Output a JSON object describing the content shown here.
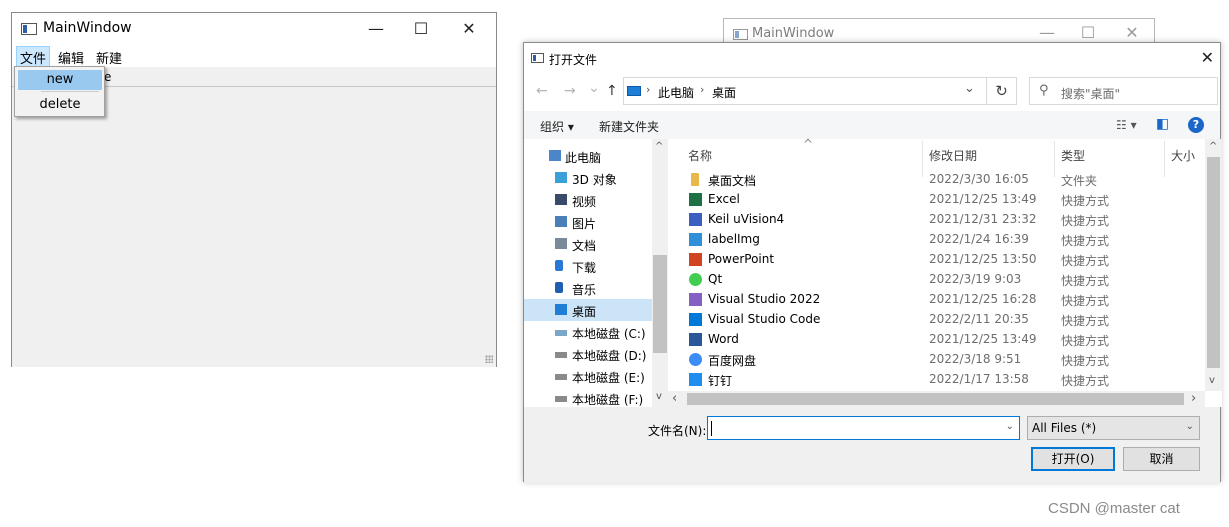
{
  "main_window": {
    "title": "MainWindow",
    "controls": {
      "minimize": "—",
      "maximize": "☐",
      "close": "✕"
    },
    "menu": [
      "文件",
      "编辑",
      "新建"
    ],
    "popup_items": [
      "new",
      "delete"
    ],
    "hidden_toolbar_fragment": "e"
  },
  "background_window": {
    "title": "MainWindow",
    "controls": {
      "minimize": "—",
      "maximize": "☐",
      "close": "✕"
    }
  },
  "dialog": {
    "title": "打开文件",
    "close": "✕",
    "nav": {
      "back": "←",
      "forward": "→",
      "recent": "⌄",
      "up": "↑"
    },
    "breadcrumb": [
      "此电脑",
      "桌面"
    ],
    "crumb_sep": "›",
    "address_dropdown": "⌄",
    "refresh": "↻",
    "search_icon": "⚲",
    "search_placeholder": "搜索\"桌面\"",
    "commands": {
      "organize": "组织 ▾",
      "new_folder": "新建文件夹",
      "view": "☷ ▾",
      "pane": "◧",
      "help": "?"
    },
    "tree": [
      {
        "label": "此电脑",
        "icon": "pc",
        "indent": 0
      },
      {
        "label": "3D 对象",
        "icon": "3d",
        "indent": 1
      },
      {
        "label": "视频",
        "icon": "video",
        "indent": 1
      },
      {
        "label": "图片",
        "icon": "picture",
        "indent": 1
      },
      {
        "label": "文档",
        "icon": "document",
        "indent": 1
      },
      {
        "label": "下载",
        "icon": "download",
        "indent": 1
      },
      {
        "label": "音乐",
        "icon": "music",
        "indent": 1
      },
      {
        "label": "桌面",
        "icon": "desktop",
        "indent": 1,
        "selected": true
      },
      {
        "label": "本地磁盘 (C:)",
        "icon": "drive-c",
        "indent": 1
      },
      {
        "label": "本地磁盘 (D:)",
        "icon": "drive",
        "indent": 1
      },
      {
        "label": "本地磁盘 (E:)",
        "icon": "drive",
        "indent": 1
      },
      {
        "label": "本地磁盘 (F:)",
        "icon": "drive",
        "indent": 1
      }
    ],
    "columns": [
      "名称",
      "修改日期",
      "类型",
      "大小"
    ],
    "sort_indicator": "^",
    "files": [
      {
        "name": "桌面文档",
        "date": "2022/3/30 16:05",
        "type": "文件夹",
        "icon": "folder",
        "color": "#e8b84a"
      },
      {
        "name": "Excel",
        "date": "2021/12/25 13:49",
        "type": "快捷方式",
        "icon": "excel",
        "color": "#1e7145"
      },
      {
        "name": "Keil uVision4",
        "date": "2021/12/31 23:32",
        "type": "快捷方式",
        "icon": "keil",
        "color": "#3b5fc0"
      },
      {
        "name": "labelImg",
        "date": "2022/1/24 16:39",
        "type": "快捷方式",
        "icon": "labelimg",
        "color": "#2f8fd8"
      },
      {
        "name": "PowerPoint",
        "date": "2021/12/25 13:50",
        "type": "快捷方式",
        "icon": "powerpoint",
        "color": "#d04423"
      },
      {
        "name": "Qt",
        "date": "2022/3/19 9:03",
        "type": "快捷方式",
        "icon": "qt",
        "color": "#41cd52"
      },
      {
        "name": "Visual Studio 2022",
        "date": "2021/12/25 16:28",
        "type": "快捷方式",
        "icon": "visual-studio",
        "color": "#865fc5"
      },
      {
        "name": "Visual Studio Code",
        "date": "2022/2/11 20:35",
        "type": "快捷方式",
        "icon": "vscode",
        "color": "#0078d7"
      },
      {
        "name": "Word",
        "date": "2021/12/25 13:49",
        "type": "快捷方式",
        "icon": "word",
        "color": "#2b579a"
      },
      {
        "name": "百度网盘",
        "date": "2022/3/18 9:51",
        "type": "快捷方式",
        "icon": "baidu-netdisk",
        "color": "#3b8cf5"
      },
      {
        "name": "钉钉",
        "date": "2022/1/17 13:58",
        "type": "快捷方式",
        "icon": "dingtalk",
        "color": "#1f8cf0"
      }
    ],
    "filename_label": "文件名(N):",
    "filename_value": "",
    "filename_dropdown": "⌄",
    "filter_value": "All Files (*)",
    "filter_dropdown": "⌄",
    "scroll": {
      "up": "▲",
      "down": "▼",
      "left": "‹",
      "right": "›",
      "tree_up": "^",
      "tree_down": "v",
      "list_up": "^",
      "list_down": "v"
    },
    "open_button": "打开(O)",
    "cancel_button": "取消"
  },
  "watermark": "CSDN @master cat"
}
